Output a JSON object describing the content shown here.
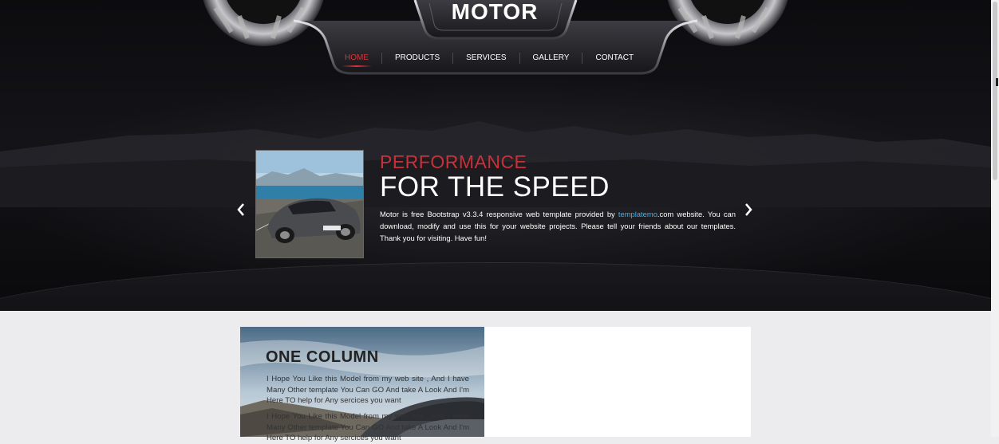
{
  "brand": {
    "logo_text": "MOTOR"
  },
  "nav": {
    "items": [
      "HOME",
      "PRODUCTS",
      "SERVICES",
      "GALLERY",
      "CONTACT"
    ],
    "active": "HOME"
  },
  "slider": {
    "subtitle": "PERFORMANCE",
    "title": "FOR THE SPEED",
    "text_before_link": "Motor is free Bootstrap v3.3.4 responsive web template provided by ",
    "link_text": "templatemo",
    "text_after_link": ".com website. You can download, modify and use this for your website projects. Please tell your friends about our templates. Thank you for visiting. Have fun!",
    "prev_icon": "chevron-left-icon",
    "next_icon": "chevron-right-icon"
  },
  "content": {
    "heading": "ONE COLUMN",
    "paragraphs": [
      "I Hope You Like this Model from my web site , And I have Many Other template You Can GO And take A Look And I'm Here TO help for Any sercices you want",
      "I Hope You Like this Model from my web site , And I have Many Other template You Can GO And take A Look And I'm Here TO help for Any sercices you want"
    ]
  },
  "colors": {
    "accent_red": "#d9343c",
    "link_blue": "#47b0e8",
    "hero_bg": "#111114",
    "page_bg": "#ececef"
  }
}
